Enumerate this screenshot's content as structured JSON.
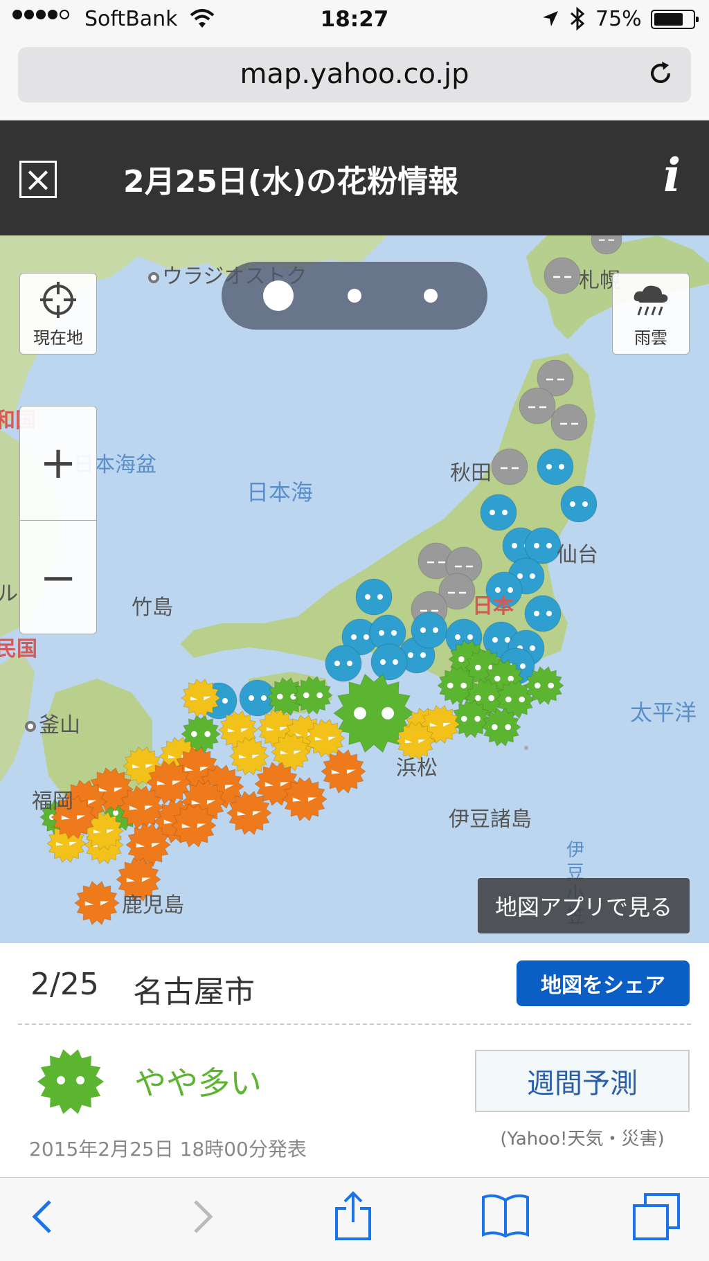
{
  "status_bar": {
    "carrier": "SoftBank",
    "time": "18:27",
    "battery": "75%",
    "battery_level": 0.75
  },
  "browser": {
    "url": "map.yahoo.co.jp"
  },
  "header": {
    "close_icon": "×",
    "title": "2月25日(水)の花粉情報",
    "info_icon": "i"
  },
  "map": {
    "labels": {
      "vladivostok": "ウラジオストク",
      "sapporo": "札幌",
      "akita": "秋田",
      "sendai": "仙台",
      "japan": "日本",
      "takeshima": "竹島",
      "busan": "釜山",
      "fukuoka": "福岡",
      "hamamatsu": "浜松",
      "izu": "伊豆諸島",
      "kagoshima": "鹿児島",
      "basin": "日本海盆",
      "sea_of_japan": "日本海",
      "pacific": "太平洋",
      "izu_vertical": "伊豆小笠",
      "china": "和国",
      "korea_l": "ル",
      "korea": "民国"
    },
    "controls": {
      "current_location": "現在地",
      "rain": "雨雲",
      "zoom_in": "+",
      "zoom_out": "−",
      "open_in_app": "地図アプリで見る"
    },
    "pager": {
      "pages": 3,
      "active_page": 1
    },
    "legend_colors": {
      "gray": "#9a9a9a",
      "blue": "#2e9fcf",
      "green": "#5cb531",
      "yellow": "#f2c21b",
      "orange": "#ee7a1c"
    }
  },
  "panel": {
    "date": "2/25",
    "city": "名古屋市",
    "share_button": "地図をシェア",
    "level": "やや多い",
    "level_icon": "pollen-green-icon",
    "weekly_button": "週間予測",
    "source": "(Yahoo!天気・災害)",
    "announced": "2015年2月25日 18時00分発表"
  },
  "toolbar": {
    "items": [
      "back-icon",
      "forward-icon",
      "share-icon",
      "bookmarks-icon",
      "tabs-icon"
    ]
  }
}
